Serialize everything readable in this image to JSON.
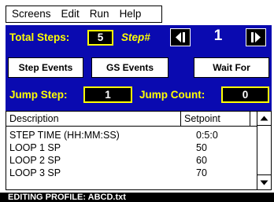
{
  "menu": {
    "items": [
      "Screens",
      "Edit",
      "Run",
      "Help"
    ]
  },
  "controls": {
    "total_steps_label": "Total Steps:",
    "total_steps_value": "5",
    "step_label": "Step#",
    "step_value": "1",
    "step_events_button": "Step Events",
    "gs_events_button": "GS Events",
    "wait_for_button": "Wait For",
    "jump_step_label": "Jump Step:",
    "jump_step_value": "1",
    "jump_count_label": "Jump Count:",
    "jump_count_value": "0"
  },
  "table": {
    "headers": [
      "Description",
      "Setpoint"
    ],
    "rows": [
      {
        "description": "STEP TIME (HH:MM:SS)",
        "setpoint": "0:5:0"
      },
      {
        "description": "LOOP 1 SP",
        "setpoint": "50"
      },
      {
        "description": "LOOP 2 SP",
        "setpoint": "60"
      },
      {
        "description": "LOOP 3 SP",
        "setpoint": "70"
      }
    ]
  },
  "status": {
    "text": "EDITING PROFILE: ABCD.txt"
  },
  "colors": {
    "panel": "#0a0ab0",
    "accent": "#ffff00",
    "status_bar": "#000000"
  }
}
